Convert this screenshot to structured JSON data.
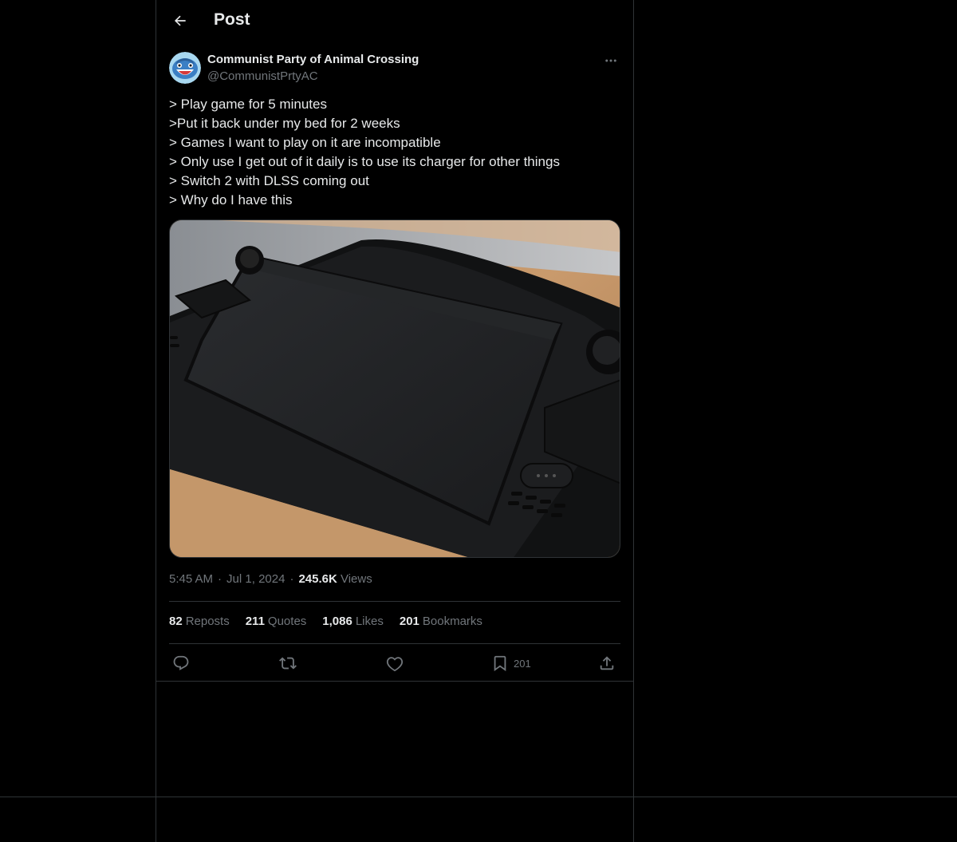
{
  "header": {
    "title": "Post"
  },
  "post": {
    "author_name": "Communist Party of Animal Crossing",
    "author_handle": "@CommunistPrtyAC",
    "lines": [
      "> Play game for 5 minutes",
      ">Put it back under my bed for 2 weeks",
      "> Games I want to play on it are incompatible",
      "> Only use I get out of it daily is to use its charger for other things",
      "> Switch 2 with DLSS coming out",
      "> Why do I have this"
    ],
    "time": "5:45 AM",
    "date": "Jul 1, 2024",
    "views_count": "245.6K",
    "views_label": "Views"
  },
  "stats": {
    "reposts_count": "82",
    "reposts_label": "Reposts",
    "quotes_count": "211",
    "quotes_label": "Quotes",
    "likes_count": "1,086",
    "likes_label": "Likes",
    "bookmarks_count": "201",
    "bookmarks_label": "Bookmarks"
  },
  "actions": {
    "bookmark_count": "201"
  },
  "icons": {
    "back": "arrow-left-icon",
    "more": "more-horizontal-icon",
    "reply": "reply-bubble-icon",
    "repost": "repost-icon",
    "like": "heart-icon",
    "bookmark": "bookmark-icon",
    "share": "share-upload-icon"
  },
  "colors": {
    "background": "#000000",
    "text_primary": "#e7e9ea",
    "text_secondary": "#71767b",
    "border": "#2f3336"
  }
}
